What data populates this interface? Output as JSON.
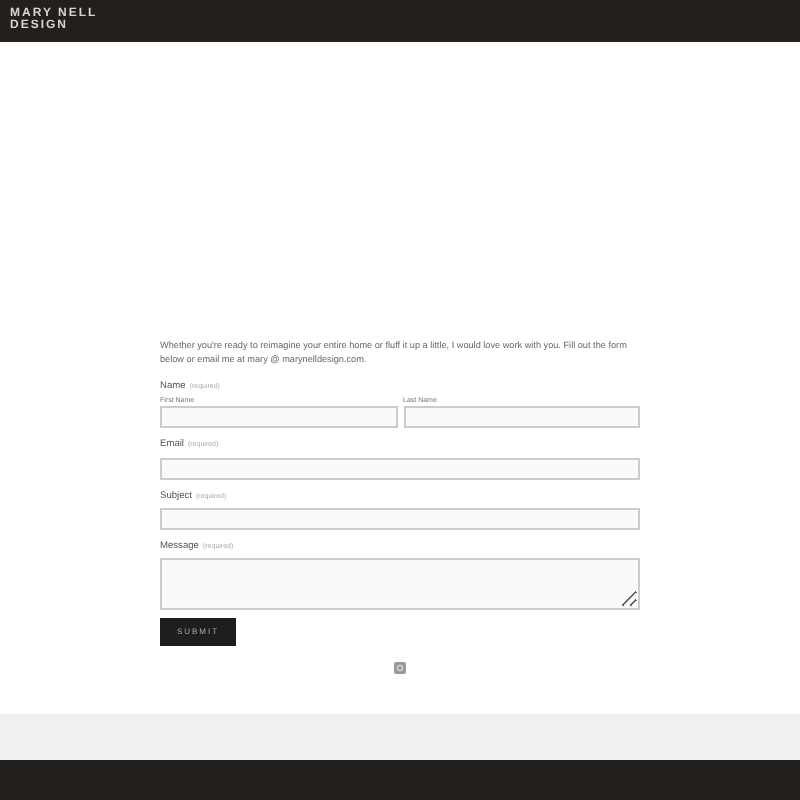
{
  "header": {
    "logo_lines": [
      "MARY NELL",
      "DESIGN"
    ]
  },
  "intro": "Whether you're ready to reimagine your entire home or fluff it up a little, I would love work with you. Fill out the form below or email me at mary @ marynelldesign.com.",
  "form": {
    "name": {
      "label": "Name",
      "required": "(required)",
      "first": "First Name",
      "last": "Last Name"
    },
    "fields": [
      {
        "kind": "input",
        "label": "Email",
        "required": "(required)"
      },
      {
        "kind": "input",
        "label": "Subject",
        "required": "(required)"
      },
      {
        "kind": "textarea",
        "label": "Message",
        "required": "(required)"
      }
    ],
    "submit": "SUBMIT"
  }
}
